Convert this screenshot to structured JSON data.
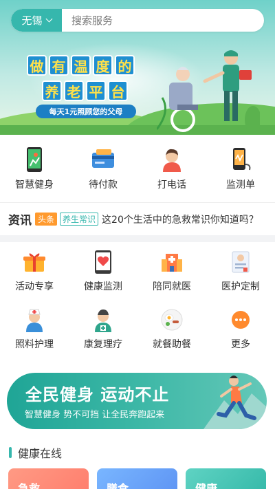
{
  "search": {
    "city": "无锡",
    "placeholder": "搜索服务"
  },
  "banner": {
    "title_line1": [
      "做",
      "有",
      "温",
      "度",
      "的"
    ],
    "title_line2": [
      "养",
      "老",
      "平",
      "台"
    ],
    "subtitle": "每天1元照顾您的父母"
  },
  "quick_actions": [
    {
      "label": "智慧健身",
      "icon": "phone-fitness-icon"
    },
    {
      "label": "待付款",
      "icon": "card-payment-icon"
    },
    {
      "label": "打电话",
      "icon": "person-call-icon"
    },
    {
      "label": "监测单",
      "icon": "monitor-device-icon"
    }
  ],
  "news": {
    "title": "资讯",
    "tag_hot": "头条",
    "tag_category": "养生常识",
    "headline": "这20个生活中的急救常识你知道吗？"
  },
  "services": [
    {
      "label": "活动专享",
      "icon": "gift-icon"
    },
    {
      "label": "健康监测",
      "icon": "heart-monitor-icon"
    },
    {
      "label": "陪同就医",
      "icon": "hospital-icon"
    },
    {
      "label": "医护定制",
      "icon": "document-icon"
    },
    {
      "label": "照料护理",
      "icon": "nurse-icon"
    },
    {
      "label": "康复理疗",
      "icon": "doctor-icon"
    },
    {
      "label": "就餐助餐",
      "icon": "meal-icon"
    },
    {
      "label": "更多",
      "icon": "more-icon"
    }
  ],
  "promo": {
    "title": "全民健身  运动不止",
    "subtitle": "智慧健身   势不可挡   让全民奔跑起来"
  },
  "health_online": {
    "title": "健康在线",
    "cards": [
      {
        "label": "急救"
      },
      {
        "label": "膳食"
      },
      {
        "label": "健康"
      }
    ]
  },
  "colors": {
    "accent": "#36b7ad",
    "hot_tag": "#ff9a2e"
  }
}
